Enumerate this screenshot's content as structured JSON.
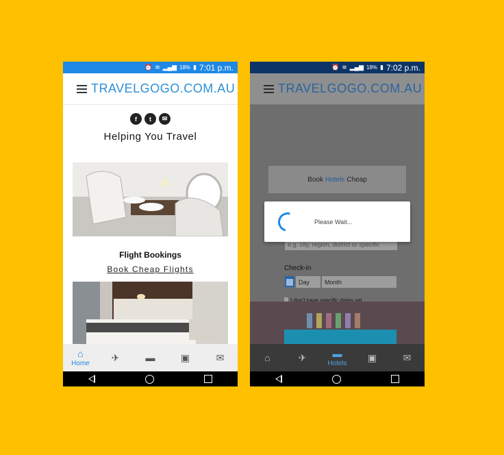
{
  "brand_name": "TRAVELGOGO.COM.AU",
  "phone1": {
    "status": {
      "battery": "18%",
      "time": "7:01 p.m."
    },
    "social_icons": [
      "facebook-icon",
      "twitter-icon",
      "email-icon"
    ],
    "social_glyphs": [
      "f",
      "t",
      "✉"
    ],
    "tagline": "Helping You Travel",
    "flight_section": {
      "title": "Flight Bookings",
      "link": "Book Cheap Flights"
    },
    "nav": {
      "home_label": "Home",
      "icons": [
        "home-icon",
        "plane-icon",
        "bed-icon",
        "briefcase-icon",
        "mail-icon"
      ]
    }
  },
  "phone2": {
    "status": {
      "battery": "18%",
      "time": "7:02 p.m."
    },
    "book_card": {
      "prefix": "Book",
      "highlight": "Hotels",
      "suffix": "Cheap"
    },
    "search_placeholder": "e.g. city, region, district or specific",
    "checkin_label": "Check-in",
    "day_placeholder": "Day",
    "month_placeholder": "Month",
    "no_dates_label": "I don't have specific dates yet",
    "dialog_text": "Please Wait...",
    "nav": {
      "hotels_label": "Hotels",
      "icons": [
        "home-icon",
        "plane-icon",
        "bed-icon",
        "briefcase-icon",
        "mail-icon"
      ]
    }
  },
  "colors": {
    "background": "#FFC000",
    "accent": "#1E88E5",
    "brand": "#2B8FD6"
  }
}
